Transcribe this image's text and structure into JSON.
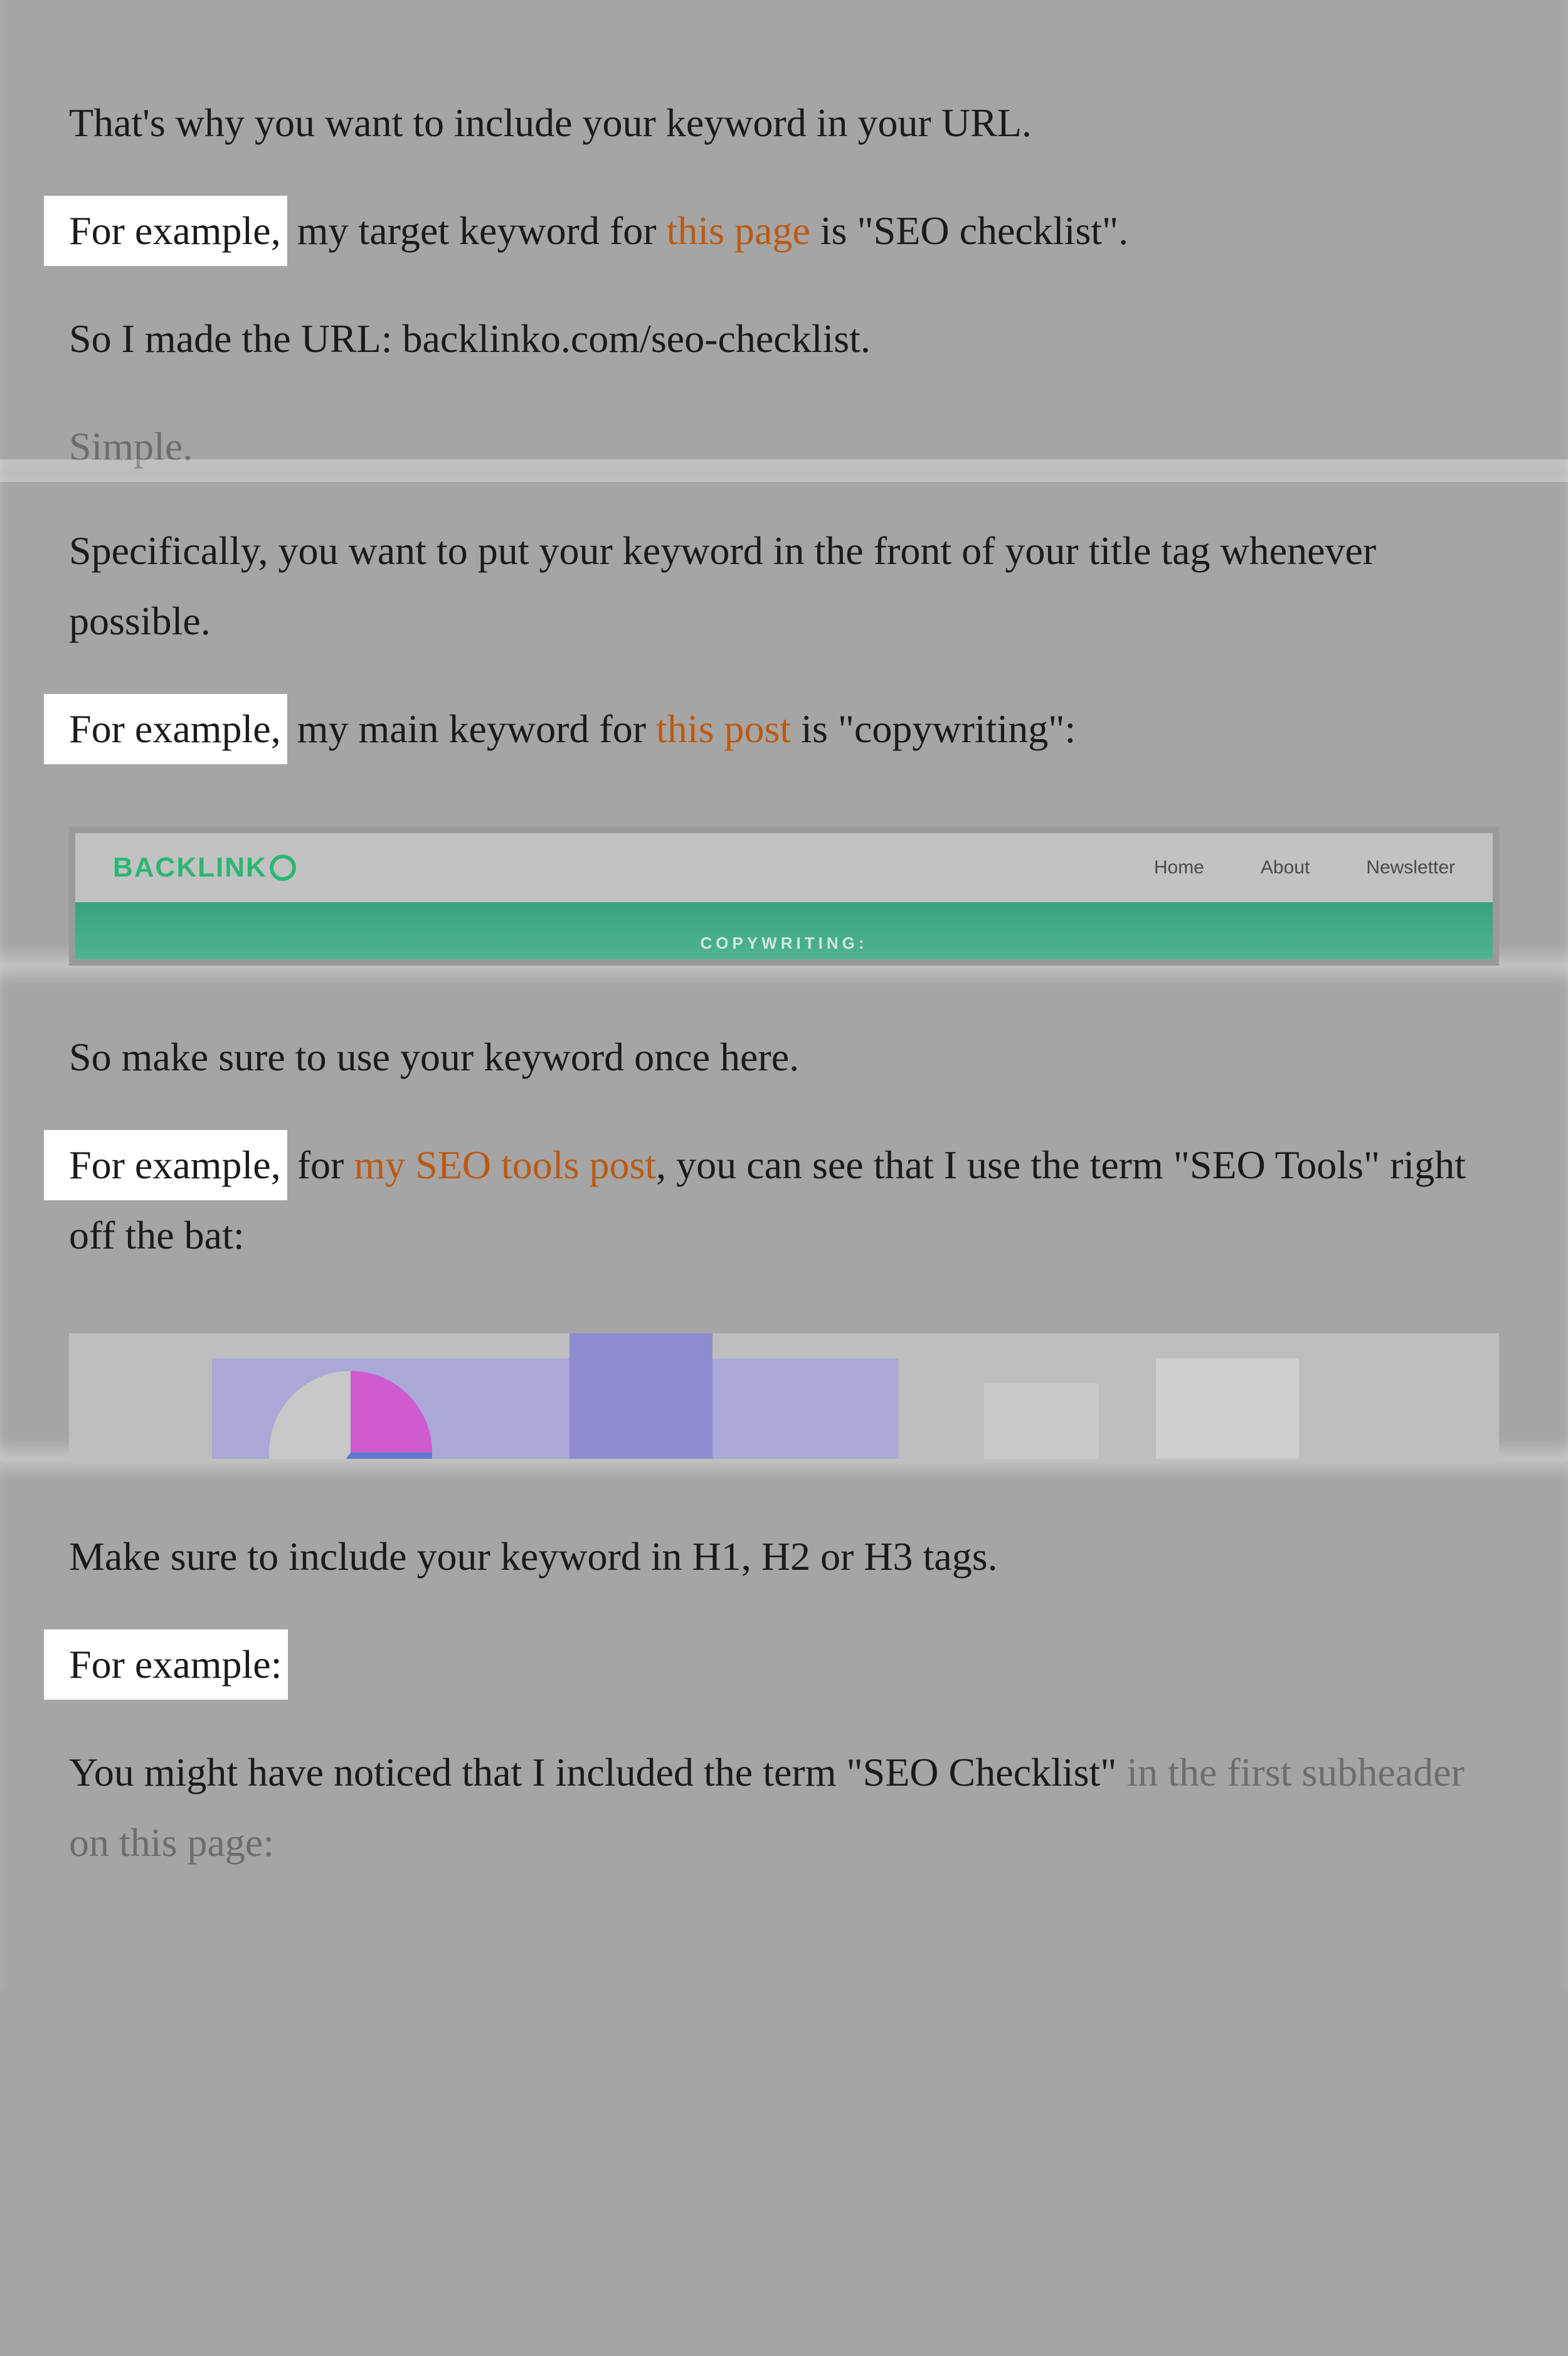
{
  "section1": {
    "p1": "That's why you want to include your keyword in your URL.",
    "p2_hl": "For example,",
    "p2_a": " my target keyword for ",
    "p2_link": "this page",
    "p2_b": " is \"SEO checklist\".",
    "p3": "So I made the URL: backlinko.com/seo-checklist.",
    "p4_faded": "Simple."
  },
  "section2": {
    "p1": "Specifically, you want to put your keyword in the front of your title tag whenever possible.",
    "p2_hl": "For example,",
    "p2_a": " my main keyword for ",
    "p2_link": "this post",
    "p2_b": " is \"copywriting\":",
    "embed": {
      "logo_text": "BACKLINK",
      "nav": [
        "Home",
        "About",
        "Newsletter"
      ],
      "hero_label": "COPYWRITING:"
    }
  },
  "section3": {
    "p1": "So make sure to use your keyword once here.",
    "p2_hl": "For example,",
    "p2_a": " for ",
    "p2_link": "my SEO tools post",
    "p2_b": ", you can see that I use the term \"SEO Tools\" right off the bat:"
  },
  "section4": {
    "p1": "Make sure to include your keyword in H1, H2 or H3 tags.",
    "p2_hl": "For example:",
    "p3_a": "You might have noticed that I included the term \"SEO Checklist\" ",
    "p3_faded": "in the first subheader on this page:"
  }
}
